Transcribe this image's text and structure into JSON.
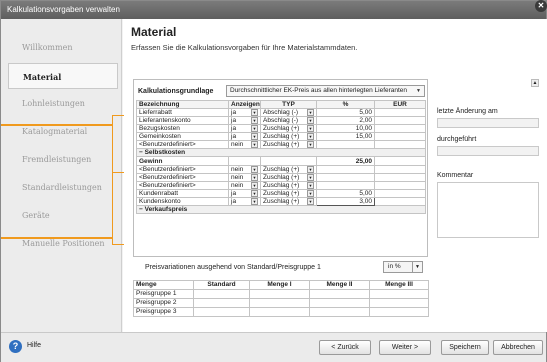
{
  "window": {
    "title": "Kalkulationsvorgaben verwalten"
  },
  "sidebar": {
    "items": [
      {
        "label": "Willkommen",
        "active": false
      },
      {
        "label": "Material",
        "active": true
      },
      {
        "label": "Lohnleistungen",
        "active": false
      },
      {
        "label": "Katalogmaterial",
        "active": false
      },
      {
        "label": "Fremdleistungen",
        "active": false
      },
      {
        "label": "Standardleistungen",
        "active": false
      },
      {
        "label": "Geräte",
        "active": false
      },
      {
        "label": "Manuelle Positionen",
        "active": false
      }
    ]
  },
  "main": {
    "title": "Material",
    "subtitle": "Erfassen Sie die Kalkulationsvorgaben für Ihre Materialstammdaten."
  },
  "calc": {
    "basis_label": "Kalkulationsgrundlage",
    "basis_value": "Durchschnittlicher EK-Preis aus allen hinterlegten Lieferanten",
    "headers": [
      "Bezeichnung",
      "Anzeigen",
      "TYP",
      "%",
      "EUR"
    ],
    "rows_a": [
      {
        "name": "Lieferrabatt",
        "show": "ja",
        "typ": "Abschlag (-)",
        "pct": "5,00",
        "eur": ""
      },
      {
        "name": "Lieferantenskonto",
        "show": "ja",
        "typ": "Abschlag (-)",
        "pct": "2,00",
        "eur": ""
      },
      {
        "name": "Bezugskosten",
        "show": "ja",
        "typ": "Zuschlag (+)",
        "pct": "10,00",
        "eur": ""
      },
      {
        "name": "Gemeinkosten",
        "show": "ja",
        "typ": "Zuschlag (+)",
        "pct": "15,00",
        "eur": ""
      },
      {
        "name": "<Benutzerdefiniert>",
        "show": "nein",
        "typ": "Zuschlag (+)",
        "pct": "",
        "eur": ""
      }
    ],
    "section_selbstkosten": "− Selbstkosten",
    "gewinn": {
      "name": "Gewinn",
      "pct": "25,00"
    },
    "rows_b": [
      {
        "name": "<Benutzerdefiniert>",
        "show": "nein",
        "typ": "Zuschlag (+)",
        "pct": "",
        "eur": ""
      },
      {
        "name": "<Benutzerdefiniert>",
        "show": "nein",
        "typ": "Zuschlag (+)",
        "pct": "",
        "eur": ""
      },
      {
        "name": "<Benutzerdefiniert>",
        "show": "nein",
        "typ": "Zuschlag (+)",
        "pct": "",
        "eur": ""
      },
      {
        "name": "Kundenrabatt",
        "show": "ja",
        "typ": "Zuschlag (+)",
        "pct": "5,00",
        "eur": ""
      },
      {
        "name": "Kundenskonto",
        "show": "ja",
        "typ": "Zuschlag (+)",
        "pct": "3,00",
        "eur": ""
      }
    ],
    "section_verkaufspreis": "− Verkaufspreis"
  },
  "price_variation": {
    "label": "Preisvariationen ausgehend von Standard/Preisgruppe 1",
    "unit_button": "in %"
  },
  "price_groups": {
    "headers": [
      "Menge",
      "Standard",
      "Menge I",
      "Menge II",
      "Menge III"
    ],
    "rows": [
      "Preisgruppe 1",
      "Preisgruppe 2",
      "Preisgruppe 3"
    ]
  },
  "right_panel": {
    "last_change_label": "letzte Änderung am",
    "done_by_label": "durchgeführt",
    "comment_label": "Kommentar"
  },
  "footer": {
    "help": "Hilfe",
    "back": "< Zurück",
    "next": "Weiter >",
    "save": "Speichern",
    "cancel": "Abbrechen"
  },
  "colors": {
    "accent_bracket": "#f09a1e",
    "help_icon": "#2f6fc0"
  }
}
